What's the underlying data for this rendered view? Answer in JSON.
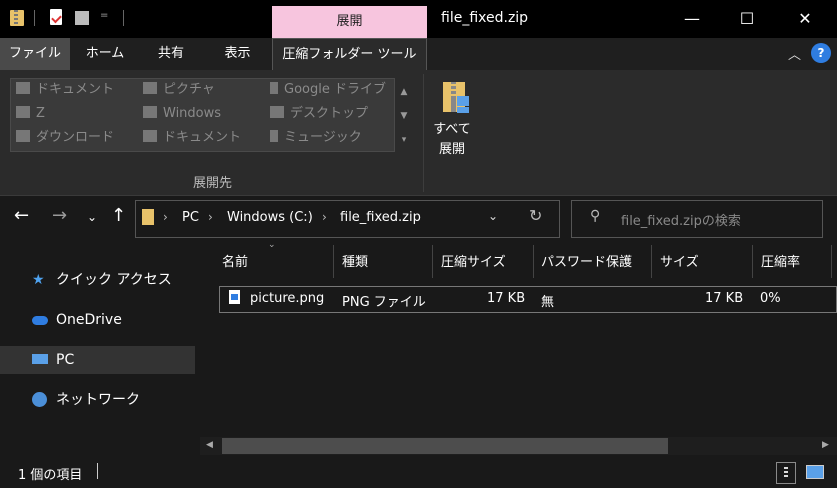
{
  "titlebar": {
    "context_tab": "展開",
    "window_title": "file_fixed.zip",
    "qat_dropdown": "=",
    "minimize": "—",
    "maximize": "☐",
    "close": "✕"
  },
  "ribbon_tabs": {
    "file": "ファイル",
    "home": "ホーム",
    "share": "共有",
    "view": "表示",
    "compressed_tools": "圧縮フォルダー ツール"
  },
  "ribbon": {
    "destination_items": [
      [
        "ドキュメント",
        "ピクチャ",
        "Google ドライブ"
      ],
      [
        "Z",
        "Windows",
        "デスクトップ"
      ],
      [
        "ダウンロード",
        "ドキュメント",
        "ミュージック"
      ]
    ],
    "group_label": "展開先",
    "extract_all_line1": "すべて",
    "extract_all_line2": "展開"
  },
  "address": {
    "crumbs": [
      "PC",
      "Windows (C:)",
      "file_fixed.zip"
    ],
    "search_placeholder": "file_fixed.zipの検索"
  },
  "nav_pane": {
    "items": [
      "クイック アクセス",
      "OneDrive",
      "PC",
      "ネットワーク"
    ]
  },
  "columns": [
    "名前",
    "種類",
    "圧縮サイズ",
    "パスワード保護",
    "サイズ",
    "圧縮率"
  ],
  "rows": [
    {
      "name": "picture.png",
      "type": "PNG ファイル",
      "compressed": "17 KB",
      "password": "無",
      "size": "17 KB",
      "ratio": "0%"
    }
  ],
  "status": {
    "item_count": "1 個の項目"
  },
  "colors": {
    "context_tab": "#f7c5de",
    "selected_nav": "#333333",
    "accent_blue": "#2f7de1"
  }
}
